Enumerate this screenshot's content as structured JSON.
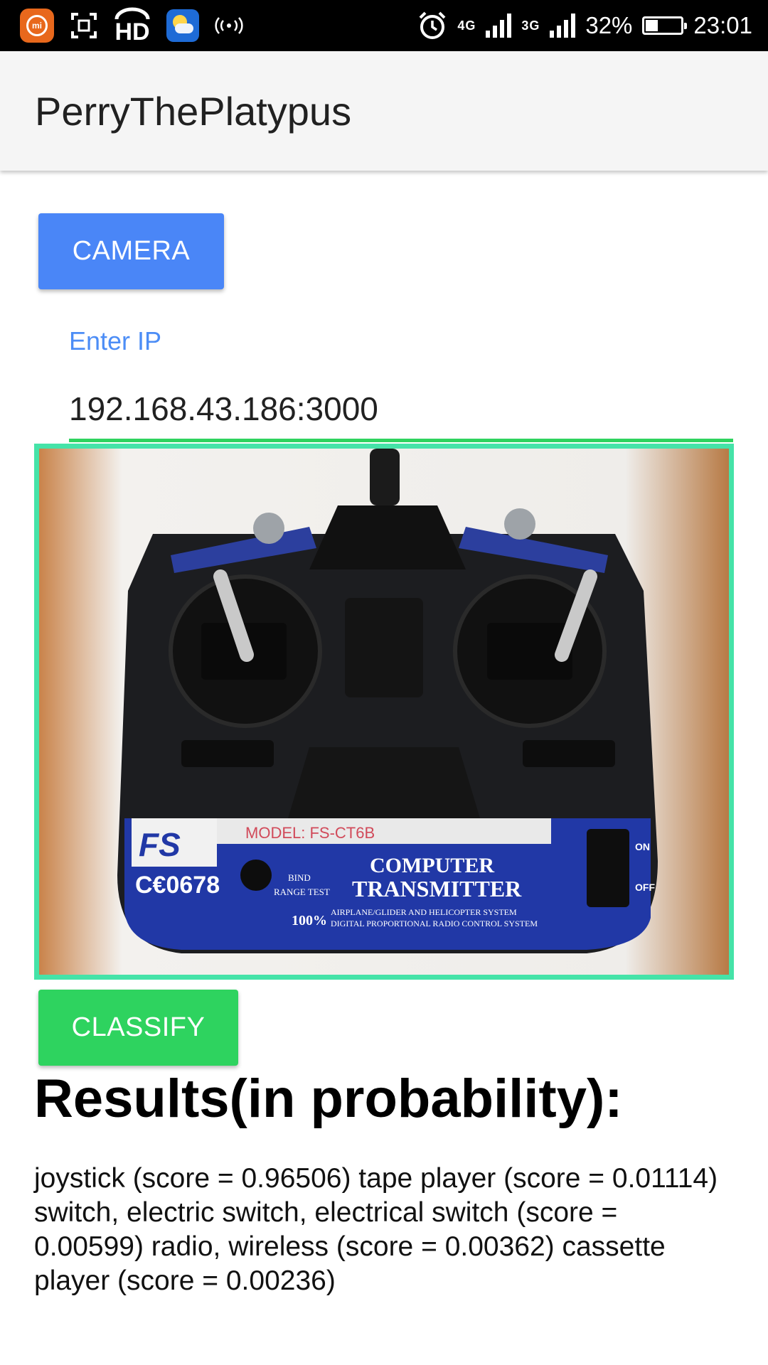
{
  "status_bar": {
    "hd_label": "HD",
    "network_4g": "4G",
    "network_3g": "3G",
    "battery_percent": "32%",
    "battery_level": 0.32,
    "time": "23:01",
    "icons": [
      "mi-app-icon",
      "screenshot-icon",
      "hd-voice-icon",
      "weather-icon",
      "hotspot-icon",
      "alarm-icon",
      "signal-icon",
      "battery-icon"
    ]
  },
  "app_bar": {
    "title": "PerryThePlatypus"
  },
  "camera_button": {
    "label": "CAMERA"
  },
  "ip_field": {
    "label": "Enter IP",
    "value": "192.168.43.186:3000"
  },
  "photo": {
    "model_text": "MODEL: FS-CT6B",
    "brand_text": "FS",
    "ce_text": "C€0678",
    "title_line1": "COMPUTER",
    "title_line2": "TRANSMITTER",
    "bind_text": "BIND",
    "range_text": "RANGE TEST",
    "percent_text": "100%",
    "sys_line1": "AIRPLANE/GLIDER AND HELICOPTER SYSTEM",
    "sys_line2": "DIGITAL PROPORTIONAL RADIO CONTROL SYSTEM",
    "on_text": "ON",
    "off_text": "OFF"
  },
  "classify_button": {
    "label": "CLASSIFY"
  },
  "results": {
    "heading": "Results(in probability):",
    "text": "joystick (score = 0.96506) tape player (score = 0.01114) switch, electric switch, electrical switch (score = 0.00599) radio, wireless (score = 0.00362) cassette player (score = 0.00236)"
  },
  "colors": {
    "camera_button": "#4a86f7",
    "classify_button": "#2ed35f",
    "accent": "#4c8df6",
    "frame": "#45e3a8",
    "ip_underline": "#2ed35f",
    "status_bar": "#000000",
    "app_bar": "#f5f5f5"
  }
}
